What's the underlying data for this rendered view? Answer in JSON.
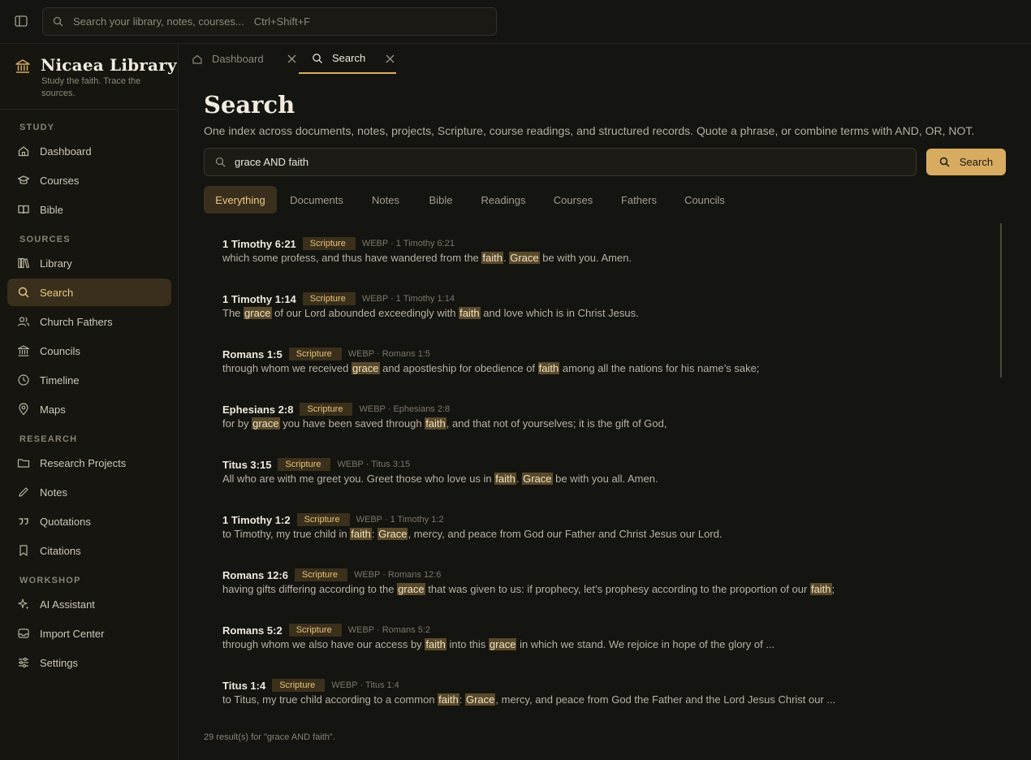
{
  "topbar": {
    "search_placeholder": "Search your library, notes, courses...",
    "search_shortcut": "Ctrl+Shift+F"
  },
  "brand": {
    "title": "Nicaea Library",
    "subtitle": "Study the faith. Trace the sources."
  },
  "sidebar": {
    "sections": [
      {
        "label": "STUDY"
      },
      {
        "label": "SOURCES"
      },
      {
        "label": "RESEARCH"
      },
      {
        "label": "WORKSHOP"
      }
    ],
    "items": [
      {
        "label": "Dashboard",
        "icon": "home-icon"
      },
      {
        "label": "Courses",
        "icon": "graduation-cap-icon"
      },
      {
        "label": "Bible",
        "icon": "open-book-icon"
      },
      {
        "label": "Library",
        "icon": "books-icon"
      },
      {
        "label": "Search",
        "icon": "search-icon",
        "active": true
      },
      {
        "label": "Church Fathers",
        "icon": "users-icon"
      },
      {
        "label": "Councils",
        "icon": "landmark-icon"
      },
      {
        "label": "Timeline",
        "icon": "clock-icon"
      },
      {
        "label": "Maps",
        "icon": "map-pin-icon"
      },
      {
        "label": "Research Projects",
        "icon": "folder-icon"
      },
      {
        "label": "Notes",
        "icon": "pencil-icon"
      },
      {
        "label": "Quotations",
        "icon": "quote-icon"
      },
      {
        "label": "Citations",
        "icon": "bookmark-icon"
      },
      {
        "label": "AI Assistant",
        "icon": "sparkles-icon"
      },
      {
        "label": "Import Center",
        "icon": "inbox-icon"
      },
      {
        "label": "Settings",
        "icon": "sliders-icon"
      }
    ]
  },
  "tabs": [
    {
      "label": "Dashboard",
      "icon": "home-icon",
      "active": false
    },
    {
      "label": "Search",
      "icon": "search-icon",
      "active": true
    }
  ],
  "main": {
    "title": "Search",
    "description": "One index across documents, notes, projects, Scripture, course readings, and structured records. Quote a phrase, or combine terms with AND, OR, NOT.",
    "query": "grace AND faith",
    "search_button": "Search",
    "filters": [
      "Everything",
      "Documents",
      "Notes",
      "Bible",
      "Readings",
      "Courses",
      "Fathers",
      "Councils"
    ],
    "active_filter": "Everything",
    "results": [
      {
        "title": "1 Timothy 6:21",
        "badge": "Scripture",
        "meta": "WEBP · 1 Timothy 6:21",
        "segments": [
          [
            "which some profess, and thus have wandered from the ",
            false
          ],
          [
            "faith",
            true
          ],
          [
            ". ",
            false
          ],
          [
            "Grace",
            true
          ],
          [
            " be with you. Amen.",
            false
          ]
        ]
      },
      {
        "title": "1 Timothy 1:14",
        "badge": "Scripture",
        "meta": "WEBP · 1 Timothy 1:14",
        "segments": [
          [
            "The ",
            false
          ],
          [
            "grace",
            true
          ],
          [
            " of our Lord abounded exceedingly with ",
            false
          ],
          [
            "faith",
            true
          ],
          [
            " and love which is in Christ Jesus.",
            false
          ]
        ]
      },
      {
        "title": "Romans 1:5",
        "badge": "Scripture",
        "meta": "WEBP · Romans 1:5",
        "segments": [
          [
            "through whom we received ",
            false
          ],
          [
            "grace",
            true
          ],
          [
            " and apostleship for obedience of ",
            false
          ],
          [
            "faith",
            true
          ],
          [
            " among all the nations for his name’s sake;",
            false
          ]
        ]
      },
      {
        "title": "Ephesians 2:8",
        "badge": "Scripture",
        "meta": "WEBP · Ephesians 2:8",
        "segments": [
          [
            "for by ",
            false
          ],
          [
            "grace",
            true
          ],
          [
            " you have been saved through ",
            false
          ],
          [
            "faith",
            true
          ],
          [
            ", and that not of yourselves; it is the gift of God,",
            false
          ]
        ]
      },
      {
        "title": "Titus 3:15",
        "badge": "Scripture",
        "meta": "WEBP · Titus 3:15",
        "segments": [
          [
            "All who are with me greet you. Greet those who love us in ",
            false
          ],
          [
            "faith",
            true
          ],
          [
            ". ",
            false
          ],
          [
            "Grace",
            true
          ],
          [
            " be with you all. Amen.",
            false
          ]
        ]
      },
      {
        "title": "1 Timothy 1:2",
        "badge": "Scripture",
        "meta": "WEBP · 1 Timothy 1:2",
        "segments": [
          [
            "to Timothy, my true child in ",
            false
          ],
          [
            "faith",
            true
          ],
          [
            ": ",
            false
          ],
          [
            "Grace",
            true
          ],
          [
            ", mercy, and peace from God our Father and Christ Jesus our Lord.",
            false
          ]
        ]
      },
      {
        "title": "Romans 12:6",
        "badge": "Scripture",
        "meta": "WEBP · Romans 12:6",
        "segments": [
          [
            "having gifts differing according to the ",
            false
          ],
          [
            "grace",
            true
          ],
          [
            " that was given to us: if prophecy, let’s prophesy according to the proportion of our ",
            false
          ],
          [
            "faith",
            true
          ],
          [
            ";",
            false
          ]
        ]
      },
      {
        "title": "Romans 5:2",
        "badge": "Scripture",
        "meta": "WEBP · Romans 5:2",
        "segments": [
          [
            "through whom we also have our access by ",
            false
          ],
          [
            "faith",
            true
          ],
          [
            " into this ",
            false
          ],
          [
            "grace",
            true
          ],
          [
            " in which we stand. We rejoice in hope of the glory of ...",
            false
          ]
        ]
      },
      {
        "title": "Titus 1:4",
        "badge": "Scripture",
        "meta": "WEBP · Titus 1:4",
        "segments": [
          [
            "to Titus, my true child according to a common ",
            false
          ],
          [
            "faith",
            true
          ],
          [
            ": ",
            false
          ],
          [
            "Grace",
            true
          ],
          [
            ", mercy, and peace from God the Father and the Lord Jesus Christ our ...",
            false
          ]
        ]
      }
    ],
    "result_count": "29 result(s) for \"grace AND faith\"."
  },
  "colors": {
    "accent": "#d7ac60",
    "active_bg": "#3a2f1c",
    "background": "#141410",
    "highlight": "#5a4a2c"
  }
}
